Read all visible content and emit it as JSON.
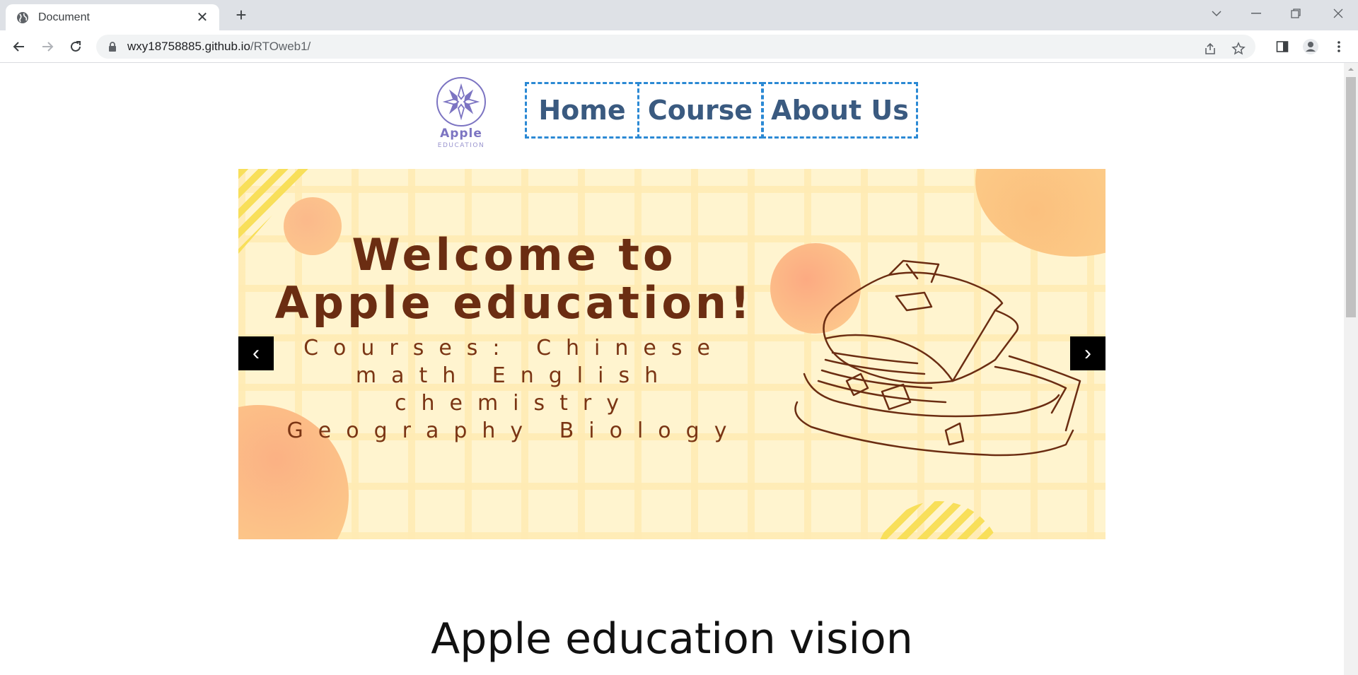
{
  "browser": {
    "tab_title": "Document",
    "url_host": "wxy18758885.github.io",
    "url_path": "/RTOweb1/"
  },
  "page": {
    "logo": {
      "name": "Apple",
      "sub": "EDUCATION"
    },
    "nav": [
      "Home",
      "Course",
      "About Us"
    ],
    "carousel": {
      "title": "Welcome to Apple education!",
      "subtitle": "Courses: Chinese math English chemistry Geography Biology",
      "prev_label": "‹",
      "next_label": "›"
    },
    "section_heading": "Apple education vision"
  },
  "colors": {
    "nav_text": "#3a5a80",
    "nav_border": "#2b89d4",
    "logo": "#7c74c2",
    "hero_text": "#6b2d12",
    "banner_bg": "#fff4cf"
  }
}
